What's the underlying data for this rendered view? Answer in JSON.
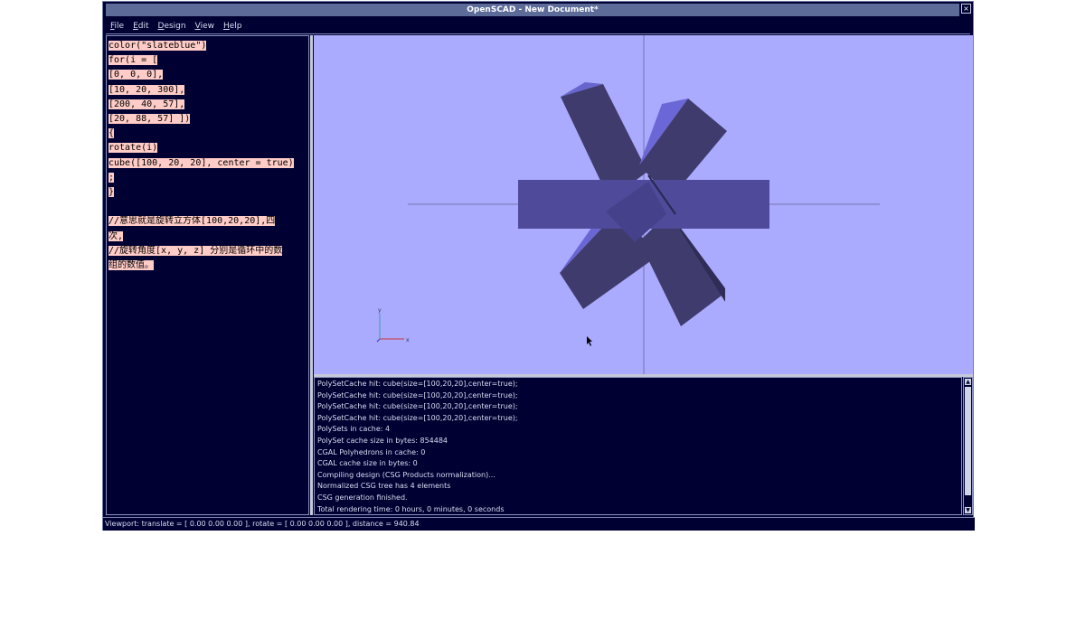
{
  "window": {
    "title": "OpenSCAD - New Document*",
    "close_glyph": "×"
  },
  "menu": {
    "items": [
      {
        "prefix": "",
        "u": "F",
        "rest": "ile"
      },
      {
        "prefix": "",
        "u": "E",
        "rest": "dit"
      },
      {
        "prefix": "",
        "u": "D",
        "rest": "esign"
      },
      {
        "prefix": "",
        "u": "V",
        "rest": "iew"
      },
      {
        "prefix": "",
        "u": "H",
        "rest": "elp"
      }
    ]
  },
  "editor": {
    "lines": [
      "color(\"slateblue\")",
      "for(i = [",
      "[0, 0, 0],",
      "[10, 20, 300],",
      "[200, 40, 57],",
      "[20, 88, 57] ])",
      "{",
      "rotate(i)",
      "cube([100, 20, 20], center = true)",
      ";",
      "}",
      "",
      "//意思就是旋转立方体[100,20,20],四",
      "次,",
      "//旋转角度[x, y, z] 分别是循环中的数",
      "组的数值。"
    ]
  },
  "viewport": {
    "background": "#aaaaff",
    "axes": {
      "x_label": "x",
      "y_label": "y"
    }
  },
  "console": {
    "lines": [
      "PolySetCache hit: cube(size=[100,20,20],center=true);",
      "PolySetCache hit: cube(size=[100,20,20],center=true);",
      "PolySetCache hit: cube(size=[100,20,20],center=true);",
      "PolySetCache hit: cube(size=[100,20,20],center=true);",
      "PolySets in cache: 4",
      "PolySet cache size in bytes: 854484",
      "CGAL Polyhedrons in cache: 0",
      "CGAL cache size in bytes: 0",
      "Compiling design (CSG Products normalization)...",
      "Normalized CSG tree has 4 elements",
      "CSG generation finished.",
      "Total rendering time: 0 hours, 0 minutes, 0 seconds"
    ]
  },
  "status": {
    "text": "Viewport: translate = [ 0.00 0.00 0.00 ], rotate = [ 0.00 0.00 0.00 ], distance = 940.84"
  }
}
